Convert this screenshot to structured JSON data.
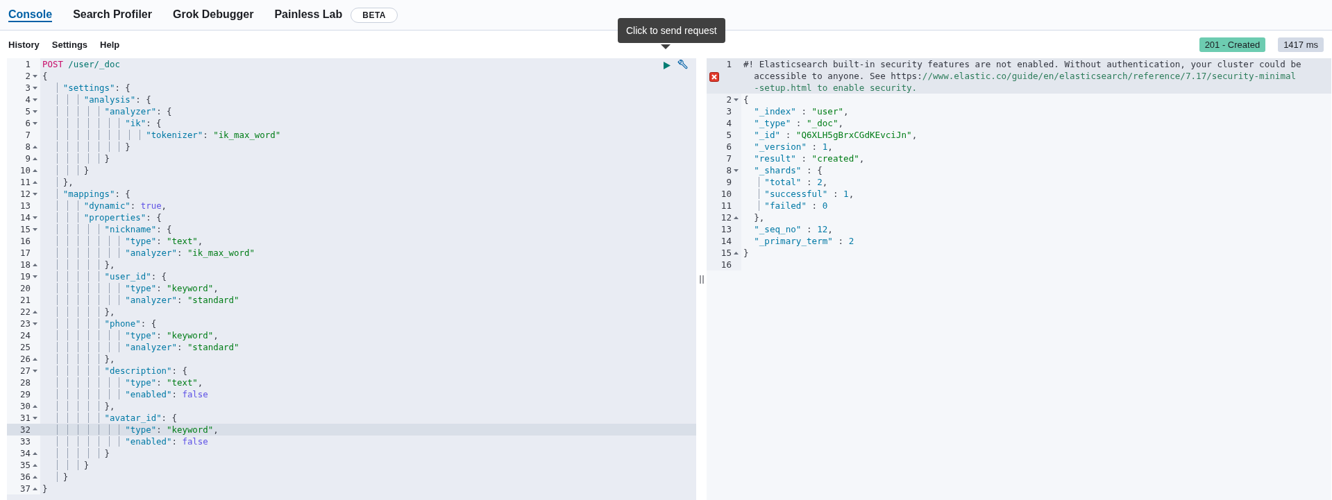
{
  "tabs": [
    {
      "label": "Console",
      "selected": true
    },
    {
      "label": "Search Profiler",
      "selected": false
    },
    {
      "label": "Grok Debugger",
      "selected": false
    },
    {
      "label": "Painless Lab",
      "selected": false,
      "badge": "BETA"
    }
  ],
  "menu": [
    "History",
    "Settings",
    "Help"
  ],
  "status": {
    "code": "201 - Created",
    "time": "1417 ms"
  },
  "tooltip": "Click to send request",
  "request": {
    "lines": [
      {
        "n": "1",
        "fold_open": false,
        "fold_close": false,
        "active": false,
        "tokens": [
          {
            "kind": "method",
            "text": "POST "
          },
          {
            "kind": "url",
            "text": "/user/_doc"
          }
        ]
      },
      {
        "n": "2",
        "fold_open": true,
        "fold_close": false,
        "active": false,
        "tokens": [
          {
            "kind": "punct",
            "text": "{"
          }
        ]
      },
      {
        "n": "3",
        "fold_open": true,
        "fold_close": false,
        "active": false,
        "tokens": [
          {
            "kind": "key",
            "text": "    \"settings\""
          },
          {
            "kind": "punct",
            "text": ": {"
          }
        ]
      },
      {
        "n": "4",
        "fold_open": true,
        "fold_close": false,
        "active": false,
        "tokens": [
          {
            "kind": "key",
            "text": "        \"analysis\""
          },
          {
            "kind": "punct",
            "text": ": {"
          }
        ]
      },
      {
        "n": "5",
        "fold_open": true,
        "fold_close": false,
        "active": false,
        "tokens": [
          {
            "kind": "key",
            "text": "            \"analyzer\""
          },
          {
            "kind": "punct",
            "text": ": {"
          }
        ]
      },
      {
        "n": "6",
        "fold_open": true,
        "fold_close": false,
        "active": false,
        "tokens": [
          {
            "kind": "key",
            "text": "                \"ik\""
          },
          {
            "kind": "punct",
            "text": ": {"
          }
        ]
      },
      {
        "n": "7",
        "fold_open": false,
        "fold_close": false,
        "active": false,
        "tokens": [
          {
            "kind": "key",
            "text": "                    \"tokenizer\""
          },
          {
            "kind": "punct",
            "text": ": "
          },
          {
            "kind": "string",
            "text": "\"ik_max_word\""
          }
        ]
      },
      {
        "n": "8",
        "fold_open": false,
        "fold_close": true,
        "active": false,
        "tokens": [
          {
            "kind": "punct",
            "text": "                }"
          }
        ]
      },
      {
        "n": "9",
        "fold_open": false,
        "fold_close": true,
        "active": false,
        "tokens": [
          {
            "kind": "punct",
            "text": "            }"
          }
        ]
      },
      {
        "n": "10",
        "fold_open": false,
        "fold_close": true,
        "active": false,
        "tokens": [
          {
            "kind": "punct",
            "text": "        }"
          }
        ]
      },
      {
        "n": "11",
        "fold_open": false,
        "fold_close": true,
        "active": false,
        "tokens": [
          {
            "kind": "punct",
            "text": "    },"
          }
        ]
      },
      {
        "n": "12",
        "fold_open": true,
        "fold_close": false,
        "active": false,
        "tokens": [
          {
            "kind": "key",
            "text": "    \"mappings\""
          },
          {
            "kind": "punct",
            "text": ": {"
          }
        ]
      },
      {
        "n": "13",
        "fold_open": false,
        "fold_close": false,
        "active": false,
        "tokens": [
          {
            "kind": "key",
            "text": "        \"dynamic\""
          },
          {
            "kind": "punct",
            "text": ": "
          },
          {
            "kind": "bool",
            "text": "true"
          },
          {
            "kind": "punct",
            "text": ","
          }
        ]
      },
      {
        "n": "14",
        "fold_open": true,
        "fold_close": false,
        "active": false,
        "tokens": [
          {
            "kind": "key",
            "text": "        \"properties\""
          },
          {
            "kind": "punct",
            "text": ": {"
          }
        ]
      },
      {
        "n": "15",
        "fold_open": true,
        "fold_close": false,
        "active": false,
        "tokens": [
          {
            "kind": "key",
            "text": "            \"nickname\""
          },
          {
            "kind": "punct",
            "text": ": {"
          }
        ]
      },
      {
        "n": "16",
        "fold_open": false,
        "fold_close": false,
        "active": false,
        "tokens": [
          {
            "kind": "key",
            "text": "                \"type\""
          },
          {
            "kind": "punct",
            "text": ": "
          },
          {
            "kind": "string",
            "text": "\"text\""
          },
          {
            "kind": "punct",
            "text": ","
          }
        ]
      },
      {
        "n": "17",
        "fold_open": false,
        "fold_close": false,
        "active": false,
        "tokens": [
          {
            "kind": "key",
            "text": "                \"analyzer\""
          },
          {
            "kind": "punct",
            "text": ": "
          },
          {
            "kind": "string",
            "text": "\"ik_max_word\""
          }
        ]
      },
      {
        "n": "18",
        "fold_open": false,
        "fold_close": true,
        "active": false,
        "tokens": [
          {
            "kind": "punct",
            "text": "            },"
          }
        ]
      },
      {
        "n": "19",
        "fold_open": true,
        "fold_close": false,
        "active": false,
        "tokens": [
          {
            "kind": "key",
            "text": "            \"user_id\""
          },
          {
            "kind": "punct",
            "text": ": {"
          }
        ]
      },
      {
        "n": "20",
        "fold_open": false,
        "fold_close": false,
        "active": false,
        "tokens": [
          {
            "kind": "key",
            "text": "                \"type\""
          },
          {
            "kind": "punct",
            "text": ": "
          },
          {
            "kind": "string",
            "text": "\"keyword\""
          },
          {
            "kind": "punct",
            "text": ","
          }
        ]
      },
      {
        "n": "21",
        "fold_open": false,
        "fold_close": false,
        "active": false,
        "tokens": [
          {
            "kind": "key",
            "text": "                \"analyzer\""
          },
          {
            "kind": "punct",
            "text": ": "
          },
          {
            "kind": "string",
            "text": "\"standard\""
          }
        ]
      },
      {
        "n": "22",
        "fold_open": false,
        "fold_close": true,
        "active": false,
        "tokens": [
          {
            "kind": "punct",
            "text": "            },"
          }
        ]
      },
      {
        "n": "23",
        "fold_open": true,
        "fold_close": false,
        "active": false,
        "tokens": [
          {
            "kind": "key",
            "text": "            \"phone\""
          },
          {
            "kind": "punct",
            "text": ": {"
          }
        ]
      },
      {
        "n": "24",
        "fold_open": false,
        "fold_close": false,
        "active": false,
        "tokens": [
          {
            "kind": "key",
            "text": "                \"type\""
          },
          {
            "kind": "punct",
            "text": ": "
          },
          {
            "kind": "string",
            "text": "\"keyword\""
          },
          {
            "kind": "punct",
            "text": ","
          }
        ]
      },
      {
        "n": "25",
        "fold_open": false,
        "fold_close": false,
        "active": false,
        "tokens": [
          {
            "kind": "key",
            "text": "                \"analyzer\""
          },
          {
            "kind": "punct",
            "text": ": "
          },
          {
            "kind": "string",
            "text": "\"standard\""
          }
        ]
      },
      {
        "n": "26",
        "fold_open": false,
        "fold_close": true,
        "active": false,
        "tokens": [
          {
            "kind": "punct",
            "text": "            },"
          }
        ]
      },
      {
        "n": "27",
        "fold_open": true,
        "fold_close": false,
        "active": false,
        "tokens": [
          {
            "kind": "key",
            "text": "            \"description\""
          },
          {
            "kind": "punct",
            "text": ": {"
          }
        ]
      },
      {
        "n": "28",
        "fold_open": false,
        "fold_close": false,
        "active": false,
        "tokens": [
          {
            "kind": "key",
            "text": "                \"type\""
          },
          {
            "kind": "punct",
            "text": ": "
          },
          {
            "kind": "string",
            "text": "\"text\""
          },
          {
            "kind": "punct",
            "text": ","
          }
        ]
      },
      {
        "n": "29",
        "fold_open": false,
        "fold_close": false,
        "active": false,
        "tokens": [
          {
            "kind": "key",
            "text": "                \"enabled\""
          },
          {
            "kind": "punct",
            "text": ": "
          },
          {
            "kind": "bool",
            "text": "false"
          }
        ]
      },
      {
        "n": "30",
        "fold_open": false,
        "fold_close": true,
        "active": false,
        "tokens": [
          {
            "kind": "punct",
            "text": "            },"
          }
        ]
      },
      {
        "n": "31",
        "fold_open": true,
        "fold_close": false,
        "active": false,
        "tokens": [
          {
            "kind": "key",
            "text": "            \"avatar_id\""
          },
          {
            "kind": "punct",
            "text": ": {"
          }
        ]
      },
      {
        "n": "32",
        "fold_open": false,
        "fold_close": false,
        "active": true,
        "tokens": [
          {
            "kind": "key",
            "text": "                \"type\""
          },
          {
            "kind": "punct",
            "text": ": "
          },
          {
            "kind": "string",
            "text": "\"keyword\""
          },
          {
            "kind": "punct",
            "text": ","
          }
        ]
      },
      {
        "n": "33",
        "fold_open": false,
        "fold_close": false,
        "active": false,
        "tokens": [
          {
            "kind": "key",
            "text": "                \"enabled\""
          },
          {
            "kind": "punct",
            "text": ": "
          },
          {
            "kind": "bool",
            "text": "false"
          }
        ]
      },
      {
        "n": "34",
        "fold_open": false,
        "fold_close": true,
        "active": false,
        "tokens": [
          {
            "kind": "punct",
            "text": "            }"
          }
        ]
      },
      {
        "n": "35",
        "fold_open": false,
        "fold_close": true,
        "active": false,
        "tokens": [
          {
            "kind": "punct",
            "text": "        }"
          }
        ]
      },
      {
        "n": "36",
        "fold_open": false,
        "fold_close": true,
        "active": false,
        "tokens": [
          {
            "kind": "punct",
            "text": "    }"
          }
        ]
      },
      {
        "n": "37",
        "fold_open": false,
        "fold_close": true,
        "active": false,
        "tokens": [
          {
            "kind": "punct",
            "text": "}"
          }
        ]
      }
    ]
  },
  "response": {
    "lines": [
      {
        "n": "1",
        "fold_open": false,
        "fold_close": false,
        "active": true,
        "error": true,
        "tokens": [
          {
            "kind": "comment",
            "text": "#! Elasticsearch built-in security features are not enabled. Without authentication, your cluster could be"
          },
          {
            "kind": "break"
          },
          {
            "kind": "comment",
            "text": "accessible to anyone. See https:"
          },
          {
            "kind": "link",
            "text": "//www.elastic.co/guide/en/elasticsearch/reference/7.17/security-minimal"
          },
          {
            "kind": "break"
          },
          {
            "kind": "link",
            "text": "-setup.html to enable security."
          }
        ]
      },
      {
        "n": "2",
        "fold_open": true,
        "fold_close": false,
        "active": false,
        "error": false,
        "tokens": [
          {
            "kind": "punct",
            "text": "{"
          }
        ]
      },
      {
        "n": "3",
        "fold_open": false,
        "fold_close": false,
        "active": false,
        "error": false,
        "tokens": [
          {
            "kind": "key",
            "text": "  \"_index\""
          },
          {
            "kind": "punct",
            "text": " : "
          },
          {
            "kind": "string",
            "text": "\"user\""
          },
          {
            "kind": "punct",
            "text": ","
          }
        ]
      },
      {
        "n": "4",
        "fold_open": false,
        "fold_close": false,
        "active": false,
        "error": false,
        "tokens": [
          {
            "kind": "key",
            "text": "  \"_type\""
          },
          {
            "kind": "punct",
            "text": " : "
          },
          {
            "kind": "string",
            "text": "\"_doc\""
          },
          {
            "kind": "punct",
            "text": ","
          }
        ]
      },
      {
        "n": "5",
        "fold_open": false,
        "fold_close": false,
        "active": false,
        "error": false,
        "tokens": [
          {
            "kind": "key",
            "text": "  \"_id\""
          },
          {
            "kind": "punct",
            "text": " : "
          },
          {
            "kind": "string",
            "text": "\"Q6XLH5gBrxCGdKEvciJn\""
          },
          {
            "kind": "punct",
            "text": ","
          }
        ]
      },
      {
        "n": "6",
        "fold_open": false,
        "fold_close": false,
        "active": false,
        "error": false,
        "tokens": [
          {
            "kind": "key",
            "text": "  \"_version\""
          },
          {
            "kind": "punct",
            "text": " : "
          },
          {
            "kind": "number",
            "text": "1"
          },
          {
            "kind": "punct",
            "text": ","
          }
        ]
      },
      {
        "n": "7",
        "fold_open": false,
        "fold_close": false,
        "active": false,
        "error": false,
        "tokens": [
          {
            "kind": "key",
            "text": "  \"result\""
          },
          {
            "kind": "punct",
            "text": " : "
          },
          {
            "kind": "string",
            "text": "\"created\""
          },
          {
            "kind": "punct",
            "text": ","
          }
        ]
      },
      {
        "n": "8",
        "fold_open": true,
        "fold_close": false,
        "active": false,
        "error": false,
        "tokens": [
          {
            "kind": "key",
            "text": "  \"_shards\""
          },
          {
            "kind": "punct",
            "text": " : {"
          }
        ]
      },
      {
        "n": "9",
        "fold_open": false,
        "fold_close": false,
        "active": false,
        "error": false,
        "tokens": [
          {
            "kind": "key",
            "text": "    \"total\""
          },
          {
            "kind": "punct",
            "text": " : "
          },
          {
            "kind": "number",
            "text": "2"
          },
          {
            "kind": "punct",
            "text": ","
          }
        ]
      },
      {
        "n": "10",
        "fold_open": false,
        "fold_close": false,
        "active": false,
        "error": false,
        "tokens": [
          {
            "kind": "key",
            "text": "    \"successful\""
          },
          {
            "kind": "punct",
            "text": " : "
          },
          {
            "kind": "number",
            "text": "1"
          },
          {
            "kind": "punct",
            "text": ","
          }
        ]
      },
      {
        "n": "11",
        "fold_open": false,
        "fold_close": false,
        "active": false,
        "error": false,
        "tokens": [
          {
            "kind": "key",
            "text": "    \"failed\""
          },
          {
            "kind": "punct",
            "text": " : "
          },
          {
            "kind": "number",
            "text": "0"
          }
        ]
      },
      {
        "n": "12",
        "fold_open": false,
        "fold_close": true,
        "active": false,
        "error": false,
        "tokens": [
          {
            "kind": "punct",
            "text": "  },"
          }
        ]
      },
      {
        "n": "13",
        "fold_open": false,
        "fold_close": false,
        "active": false,
        "error": false,
        "tokens": [
          {
            "kind": "key",
            "text": "  \"_seq_no\""
          },
          {
            "kind": "punct",
            "text": " : "
          },
          {
            "kind": "number",
            "text": "12"
          },
          {
            "kind": "punct",
            "text": ","
          }
        ]
      },
      {
        "n": "14",
        "fold_open": false,
        "fold_close": false,
        "active": false,
        "error": false,
        "tokens": [
          {
            "kind": "key",
            "text": "  \"_primary_term\""
          },
          {
            "kind": "punct",
            "text": " : "
          },
          {
            "kind": "number",
            "text": "2"
          }
        ]
      },
      {
        "n": "15",
        "fold_open": false,
        "fold_close": true,
        "active": false,
        "error": false,
        "tokens": [
          {
            "kind": "punct",
            "text": "}"
          }
        ]
      },
      {
        "n": "16",
        "fold_open": false,
        "fold_close": false,
        "active": false,
        "error": false
      }
    ]
  }
}
